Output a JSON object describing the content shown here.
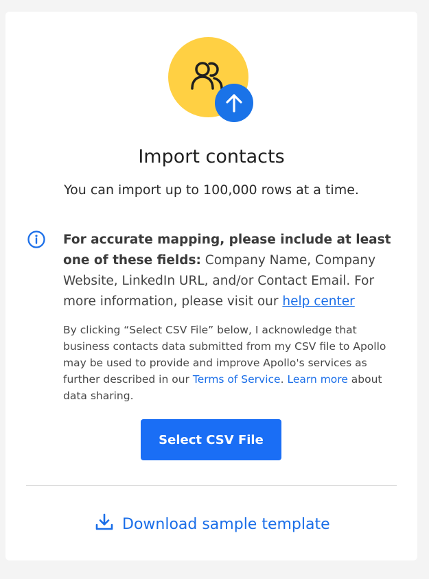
{
  "header": {
    "title": "Import contacts",
    "subtitle": "You can import up to 100,000 rows at a time."
  },
  "info": {
    "bold_prefix": "For accurate mapping, please include at least one of these fields:",
    "body": " Company Name, Company Website, LinkedIn URL, and/or Contact Email. For more information, please visit our ",
    "help_link": "help center"
  },
  "disclaimer": {
    "text1": "By clicking “Select CSV File” below, I acknowledge that business contacts data submitted from my CSV file to Apollo may be used to provide and improve Apollo's services as further described in our ",
    "terms_link": "Terms of Service",
    "text2": ". ",
    "learn_link": "Learn more",
    "text3": " about data sharing."
  },
  "actions": {
    "select_csv_label": "Select CSV File",
    "download_label": "Download sample template"
  },
  "colors": {
    "accent": "#1a6ee8",
    "hero_circle": "#ffd043",
    "button": "#1a6ef5"
  },
  "icons": {
    "hero": "people-icon",
    "badge": "arrow-up-icon",
    "info": "info-icon",
    "download": "download-icon"
  }
}
